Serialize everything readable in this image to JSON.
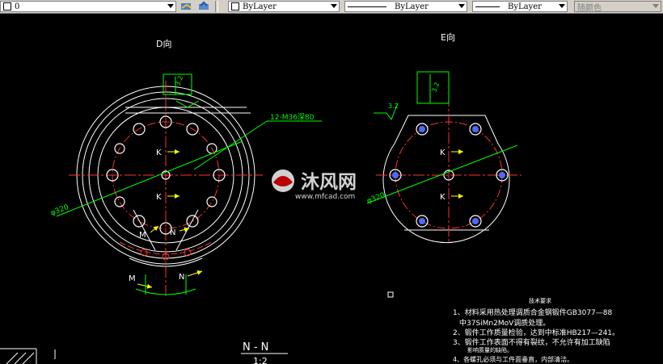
{
  "toolbar": {
    "layer_value": "0",
    "color_value": "ByLayer",
    "linetype_value": "ByLayer",
    "lineweight_value": "ByLayer",
    "plotstyle_value": "随颜色"
  },
  "views": {
    "left_title": "D向",
    "right_title": "E向",
    "roughness_left": "3.2",
    "roughness_right_top": "3.2",
    "roughness_right_side": "3.2",
    "bolt_callout": "12-M36深80",
    "dia_left": "φ320",
    "dia_right": "φ320",
    "k_label": "K",
    "m_label": "M",
    "n_label": "N"
  },
  "section": {
    "title": "N - N",
    "scale": "1:2"
  },
  "watermark": {
    "brand": "沐风网",
    "url": "www.mfcad.com"
  },
  "notes": {
    "heading": "技术要求",
    "line1": "1、材料采用热处理调质合金钢锻件GB3077—88",
    "line2": "中37SiMn2MoV调质处理。",
    "line3": "2、锻件工作质量检验，达到中标准HB217—241。",
    "line4": "3、锻件工作表面不得有裂纹，不允许有加工缺陷",
    "line5": "影响质量的缺陷。",
    "line6": "4、各螺孔必须与工件面垂直，内部清洁。"
  },
  "colors": {
    "background": "#000000",
    "outline": "#ffffff",
    "centerline": "#ff0000",
    "dimension": "#00ff00",
    "arrow": "#ffff00"
  }
}
